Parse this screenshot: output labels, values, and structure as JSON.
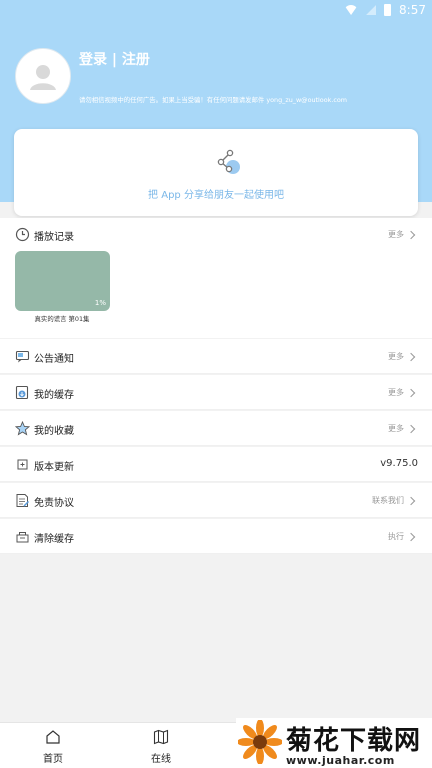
{
  "status": {
    "time": "8:57"
  },
  "profile": {
    "login_label": "登录 | 注册",
    "notice": "请勿相信视频中的任何广告。如果上当受骗！有任何问题请发邮件 yong_zu_w@outlook.com"
  },
  "share": {
    "text": "把 App 分享给朋友一起使用吧"
  },
  "history": {
    "title": "播放记录",
    "more": "更多",
    "item": {
      "title": "真实的谎言 第01集",
      "progress": "1%"
    }
  },
  "menu": [
    {
      "label": "公告通知",
      "action": "更多"
    },
    {
      "label": "我的缓存",
      "action": "更多"
    },
    {
      "label": "我的收藏",
      "action": "更多"
    },
    {
      "label": "版本更新",
      "value": "v9.75.0"
    },
    {
      "label": "免责协议",
      "action": "联系我们"
    },
    {
      "label": "清除缓存",
      "action": "执行"
    }
  ],
  "tabs": [
    {
      "label": "首页",
      "icon": "home-icon"
    },
    {
      "label": "在线",
      "icon": "map-icon"
    }
  ],
  "watermark": {
    "title": "菊花下载网",
    "url": "www.juahar.com"
  },
  "colors": {
    "header": "#a9d8f8",
    "accent": "#7ab7e8"
  }
}
